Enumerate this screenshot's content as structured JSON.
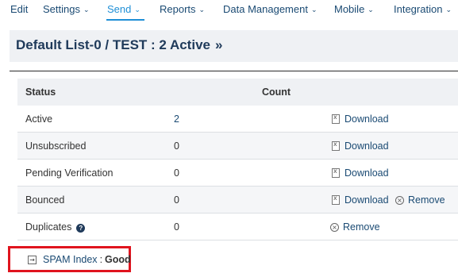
{
  "nav": {
    "items": [
      {
        "label": "Edit",
        "chevron": false
      },
      {
        "label": "Settings",
        "chevron": true
      },
      {
        "label": "Send",
        "chevron": true,
        "active": true
      },
      {
        "label": "Reports",
        "chevron": true
      },
      {
        "label": "Data Management",
        "chevron": true
      },
      {
        "label": "Mobile",
        "chevron": true
      },
      {
        "label": "Integration",
        "chevron": true
      }
    ]
  },
  "header": {
    "title": "Default List-0 / TEST :  2 Active",
    "more_glyph": "»"
  },
  "table": {
    "columns": {
      "status": "Status",
      "count": "Count"
    },
    "rows": [
      {
        "status": "Active",
        "count": "2",
        "download": "Download",
        "remove": ""
      },
      {
        "status": "Unsubscribed",
        "count": "0",
        "download": "Download",
        "remove": ""
      },
      {
        "status": "Pending Verification",
        "count": "0",
        "download": "Download",
        "remove": ""
      },
      {
        "status": "Bounced",
        "count": "0",
        "download": "Download",
        "remove": "Remove"
      },
      {
        "status": "Duplicates",
        "count": "0",
        "download": "",
        "remove": "Remove"
      }
    ]
  },
  "spam": {
    "label": "SPAM Index",
    "colon": ":",
    "value": "Good"
  },
  "colors": {
    "accent": "#1f8fd6",
    "nav_text": "#1a4a73",
    "header_bg": "#eff1f4",
    "highlight_border": "#e0141e"
  }
}
